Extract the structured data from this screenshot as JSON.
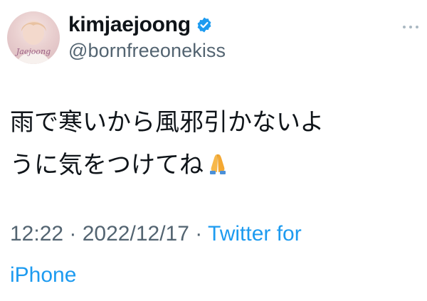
{
  "author": {
    "display_name": "kimjaejoong",
    "handle": "@bornfreeonekiss",
    "verified": true,
    "avatar_signature": "Jaejoong",
    "brand_color": "#1d9bf0"
  },
  "tweet": {
    "text_lines": [
      "雨で寒いから風邪引かないよ",
      "うに気をつけてね"
    ],
    "emoji": "folded-hands"
  },
  "meta": {
    "time": "12:22",
    "separator": " · ",
    "date": "2022/12/17",
    "source_label": "Twitter for",
    "source_label_2": "iPhone"
  },
  "icons": {
    "more": "more-horizontal-icon",
    "verified": "verified-badge-icon"
  }
}
